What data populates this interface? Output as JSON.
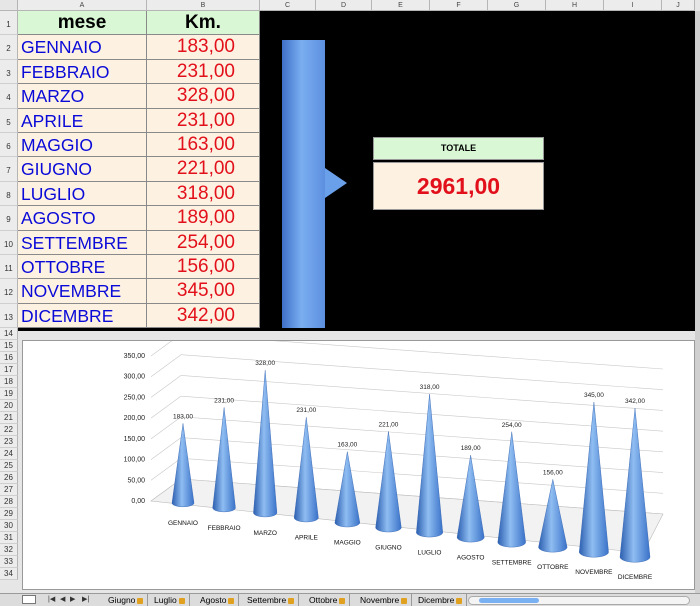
{
  "columns": [
    "A",
    "B",
    "C",
    "D",
    "E",
    "F",
    "G",
    "H",
    "I",
    "J"
  ],
  "rows": [
    "1",
    "2",
    "3",
    "4",
    "5",
    "6",
    "7",
    "8",
    "9",
    "10",
    "11",
    "12",
    "13",
    "14",
    "15",
    "16",
    "17",
    "18",
    "19",
    "20",
    "21",
    "22",
    "23",
    "24",
    "25",
    "26",
    "27",
    "28",
    "29",
    "30",
    "31",
    "32",
    "33",
    "34"
  ],
  "table": {
    "header_month": "mese",
    "header_km": "Km.",
    "months": [
      "GENNAIO",
      "FEBBRAIO",
      "MARZO",
      "APRILE",
      "MAGGIO",
      "GIUGNO",
      "LUGLIO",
      "AGOSTO",
      "SETTEMBRE",
      "OTTOBRE",
      "NOVEMBRE",
      "DICEMBRE"
    ],
    "km": [
      "183,00",
      "231,00",
      "328,00",
      "231,00",
      "163,00",
      "221,00",
      "318,00",
      "189,00",
      "254,00",
      "156,00",
      "345,00",
      "342,00"
    ]
  },
  "totale": {
    "label": "TOTALE",
    "value": "2961,00"
  },
  "colors": {
    "month_text": "#0a0ad8",
    "km_text": "#e2101a",
    "header_fill": "#d9f7d4",
    "cell_fill": "#fdf1e2",
    "cone": "#4a86d8"
  },
  "chart_data": {
    "type": "bar",
    "style": "3d-cone",
    "categories": [
      "GENNAIO",
      "FEBBRAIO",
      "MARZO",
      "APRILE",
      "MAGGIO",
      "GIUGNO",
      "LUGLIO",
      "AGOSTO",
      "SETTEMBRE",
      "OTTOBRE",
      "NOVEMBRE",
      "DICEMBRE"
    ],
    "values": [
      183,
      231,
      328,
      231,
      163,
      221,
      318,
      189,
      254,
      156,
      345,
      342
    ],
    "data_labels": [
      "183,00",
      "231,00",
      "328,00",
      "231,00",
      "163,00",
      "221,00",
      "318,00",
      "189,00",
      "254,00",
      "156,00",
      "345,00",
      "342,00"
    ],
    "yticks": [
      "0,00",
      "50,00",
      "100,00",
      "150,00",
      "200,00",
      "250,00",
      "300,00",
      "350,00"
    ],
    "ylim": [
      0,
      350
    ],
    "grid": true,
    "legend": "none"
  },
  "sheet_tabs": {
    "nav": [
      "|◀",
      "◀",
      "▶",
      "▶|"
    ],
    "tabs": [
      "Giugno",
      "Luglio",
      "Agosto",
      "Settembre",
      "Ottobre",
      "Novembre",
      "Dicembre"
    ]
  }
}
